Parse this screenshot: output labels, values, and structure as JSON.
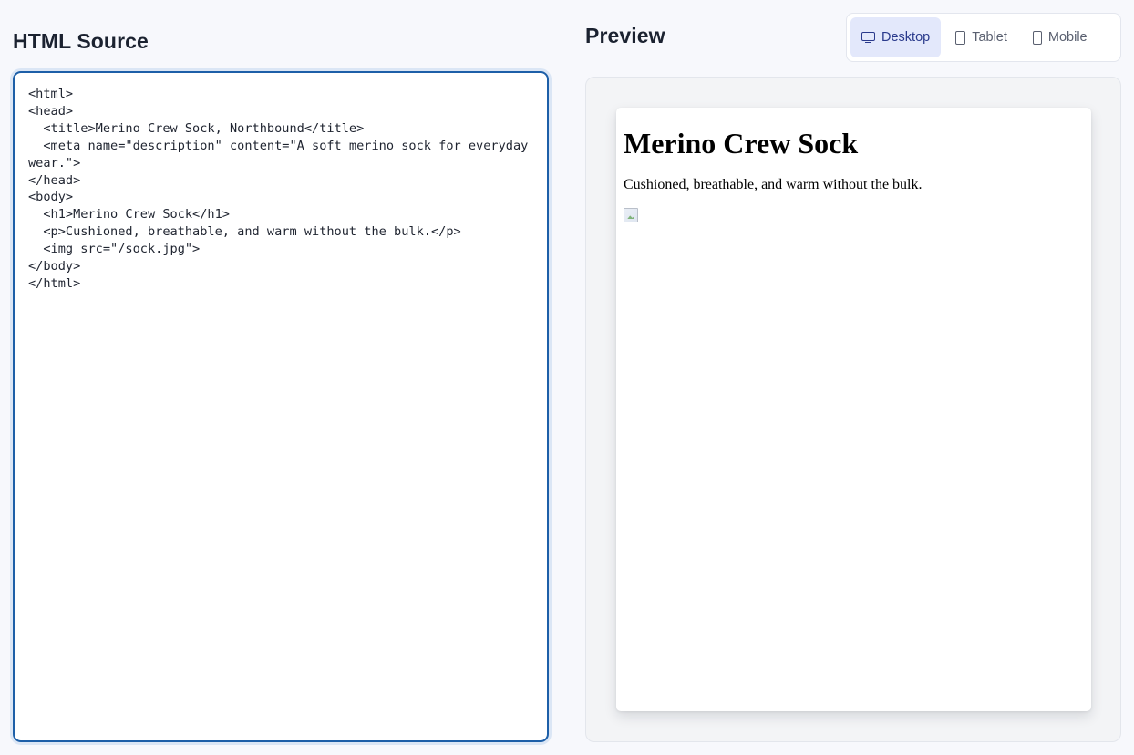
{
  "source_panel": {
    "title": "HTML Source",
    "code": "<html>\n<head>\n  <title>Merino Crew Sock, Northbound</title>\n  <meta name=\"description\" content=\"A soft merino sock for everyday wear.\">\n</head>\n<body>\n  <h1>Merino Crew Sock</h1>\n  <p>Cushioned, breathable, and warm without the bulk.</p>\n  <img src=\"/sock.jpg\">\n</body>\n</html>"
  },
  "preview_panel": {
    "title": "Preview",
    "devices": [
      {
        "label": "Desktop",
        "icon": "monitor-icon",
        "active": true
      },
      {
        "label": "Tablet",
        "icon": "tablet-icon",
        "active": false
      },
      {
        "label": "Mobile",
        "icon": "mobile-icon",
        "active": false
      }
    ],
    "rendered": {
      "heading": "Merino Crew Sock",
      "paragraph": "Cushioned, breathable, and warm without the bulk.",
      "image_icon": "broken-image-icon"
    }
  },
  "colors": {
    "accent_border": "#1d5fa8",
    "active_tab_bg": "#e3e8fb",
    "active_tab_text": "#2a3a8c"
  }
}
